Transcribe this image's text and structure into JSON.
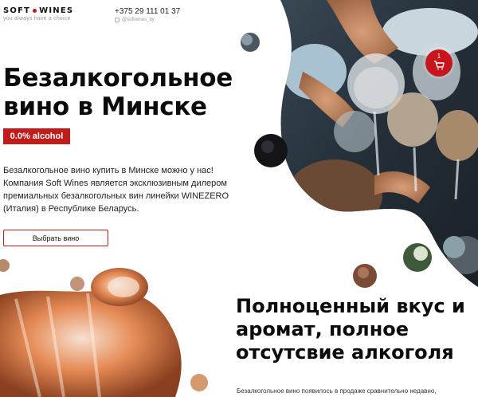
{
  "logo": {
    "brand": "SOFT WINES",
    "brand_left": "SOFT",
    "brand_right": "WINES",
    "tagline": "you always have a choice"
  },
  "contacts": {
    "phone": "+375 29 111 01 37",
    "instagram": "@softwines_by"
  },
  "hero": {
    "title": "Безалкогольное вино в Минске",
    "badge": "0.0% alcohol",
    "description": "Безалкогольное вино купить в Минске можно у нас! Компания Soft Wines является эксклюзивным дилером премиальных безалкогольных вин линейки WINEZERO (Италия) в Республике Беларусь.",
    "button_label": "Выбрать вино"
  },
  "cart": {
    "count": "1"
  },
  "section2": {
    "title": "Полноценный вкус и аромат, полное отсутсвие алкоголя",
    "text": "Безалкогольное вино появилось в продаже сравнительно недавно,"
  },
  "colors": {
    "accent": "#c11c1c",
    "cart": "#c8141b"
  },
  "icons": {
    "cart": "shopping-cart-icon",
    "instagram": "instagram-icon"
  }
}
